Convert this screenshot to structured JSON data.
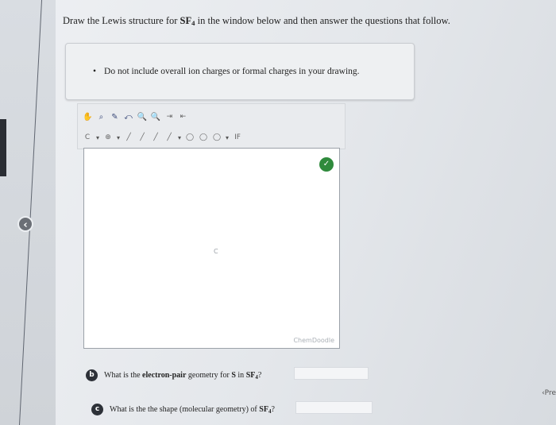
{
  "question": {
    "text_before": "Draw the Lewis structure for ",
    "formula": "SF",
    "formula_sub": "4",
    "text_after": " in the window below and then answer the questions that follow."
  },
  "note": {
    "bullet": "•",
    "text": "Do not include overall ion charges or formal charges in your drawing."
  },
  "toolbar": {
    "row1": [
      "✋",
      "⌕",
      "✎",
      "⤺",
      "🔍",
      "🔍",
      "⇥",
      "⇤"
    ],
    "row2_labels": [
      "C",
      "⊕",
      "╱",
      "╱",
      "╱",
      "╱",
      "◯",
      "◯",
      "◯",
      "IF"
    ],
    "dropdown": "▾"
  },
  "canvas": {
    "hint": "C",
    "brand": "ChemDoodle"
  },
  "icons": {
    "back": "‹",
    "check": "✓",
    "prev": "‹Pre"
  },
  "questions": {
    "b": {
      "badge": "b",
      "text_before": "What is the ",
      "bold": "electron-pair",
      "text_after": " geometry for ",
      "formula_main": "S",
      "formula_in": " in ",
      "formula": "SF",
      "formula_sub": "4",
      "qmark": "?"
    },
    "c": {
      "badge": "c",
      "text": "What is the the shape (molecular geometry) of ",
      "formula": "SF",
      "formula_sub": "4",
      "qmark": "?"
    }
  }
}
